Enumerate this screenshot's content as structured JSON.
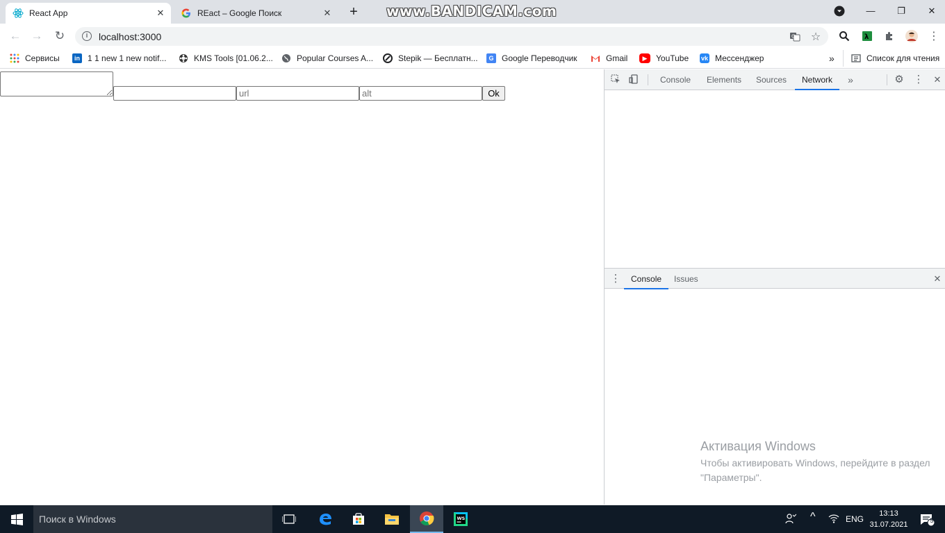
{
  "tabs": [
    {
      "title": "React App",
      "favicon": "react-icon"
    },
    {
      "title": "REact – Google Поиск",
      "favicon": "google-icon"
    }
  ],
  "watermark": "www.BANDICAM.com",
  "address": {
    "url": "localhost:3000"
  },
  "bookmarks": [
    {
      "label": "Сервисы",
      "icon": "apps-grid-icon"
    },
    {
      "label": "1 1 new 1 new notif...",
      "icon": "linkedin-icon"
    },
    {
      "label": "KMS Tools [01.06.2...",
      "icon": "kms-icon"
    },
    {
      "label": "Popular Courses A...",
      "icon": "globe-icon"
    },
    {
      "label": "Stepik — Бесплатн...",
      "icon": "stepik-icon"
    },
    {
      "label": "Google Переводчик",
      "icon": "translate-icon"
    },
    {
      "label": "Gmail",
      "icon": "gmail-icon"
    },
    {
      "label": "YouTube",
      "icon": "youtube-icon"
    },
    {
      "label": "Мессенджер",
      "icon": "vk-icon"
    }
  ],
  "bookmarks_overflow": "»",
  "reading_list": "Список для чтения",
  "page": {
    "textarea_value": "",
    "input1_value": "",
    "input1_placeholder": "",
    "url_placeholder": "url",
    "alt_placeholder": "alt",
    "ok_label": "Ok"
  },
  "devtools": {
    "tabs": [
      "Console",
      "Elements",
      "Sources",
      "Network"
    ],
    "active_tab": "Network",
    "more": "»",
    "drawer_tabs": [
      "Console",
      "Issues"
    ],
    "drawer_active": "Console"
  },
  "activation": {
    "title": "Активация Windows",
    "text": "Чтобы активировать Windows, перейдите в раздел \"Параметры\"."
  },
  "taskbar": {
    "search_placeholder": "Поиск в Windows",
    "lang": "ENG",
    "time": "13:13",
    "date": "31.07.2021",
    "notification_count": "5"
  },
  "colors": {
    "tab_strip": "#dee1e6",
    "accent": "#1a73e8",
    "taskbar": "#0f1a26"
  }
}
